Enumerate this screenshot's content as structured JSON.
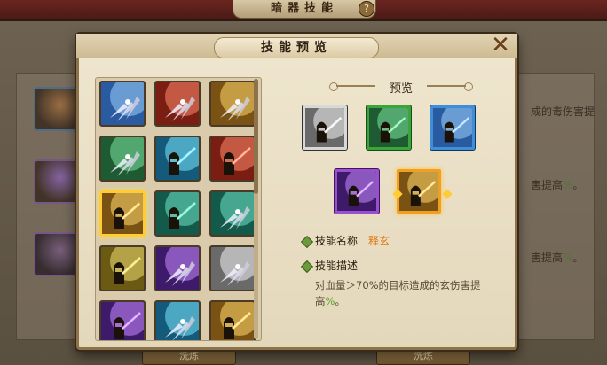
{
  "background": {
    "title": "暗器技能",
    "help_icon": "?",
    "side_texts": [
      {
        "pre": "成的毒伤害提",
        "hl": ""
      },
      {
        "pre": "害提高",
        "hl": "%",
        "post": "。"
      },
      {
        "pre": "害提高",
        "hl": "%",
        "post": "。"
      }
    ],
    "buttons": [
      "洗炼",
      "洗炼"
    ]
  },
  "dialog": {
    "title": "技能预览",
    "close_icon": "✕"
  },
  "grid": {
    "cells": [
      {
        "icon": "silver-blades-icon",
        "tint": "blue"
      },
      {
        "icon": "red-blades-icon",
        "tint": "red"
      },
      {
        "icon": "gold-blades-icon",
        "tint": "gold"
      },
      {
        "icon": "green-blades-icon",
        "tint": "green"
      },
      {
        "icon": "knight-blue-icon",
        "tint": "cyan"
      },
      {
        "icon": "knight-red-icon",
        "tint": "red"
      },
      {
        "icon": "knight-gold-icon",
        "tint": "gold",
        "selected": true
      },
      {
        "icon": "knight-teal-icon",
        "tint": "teal"
      },
      {
        "icon": "shield-teal-icon",
        "tint": "teal"
      },
      {
        "icon": "armor-yellow-icon",
        "tint": "yellow"
      },
      {
        "icon": "shield-purple-icon",
        "tint": "purple"
      },
      {
        "icon": "shield-white-icon",
        "tint": "white"
      },
      {
        "icon": "warrior-purple-icon",
        "tint": "purple"
      },
      {
        "icon": "shield-cyan-icon",
        "tint": "cyan"
      },
      {
        "icon": "armor-gold-icon",
        "tint": "gold"
      }
    ]
  },
  "preview": {
    "label": "预览",
    "icons": [
      {
        "icon": "knight-white-frame-icon",
        "frame": "white"
      },
      {
        "icon": "knight-green-frame-icon",
        "frame": "green"
      },
      {
        "icon": "knight-blue-frame-icon",
        "frame": "blue"
      },
      {
        "icon": "knight-purple-frame-icon",
        "frame": "purple"
      },
      {
        "icon": "knight-orange-frame-icon",
        "frame": "orange",
        "selected": true
      }
    ],
    "name_label": "技能名称",
    "name_value": "释玄",
    "desc_label": "技能描述",
    "desc_pre": "对血量＞70%的目标造成的玄伤害提高",
    "desc_hl": "%",
    "desc_post": "。"
  },
  "colors": {
    "accent": "#e07a14",
    "highlight": "#5ca02a",
    "selected_frame": "#ffcc33"
  }
}
